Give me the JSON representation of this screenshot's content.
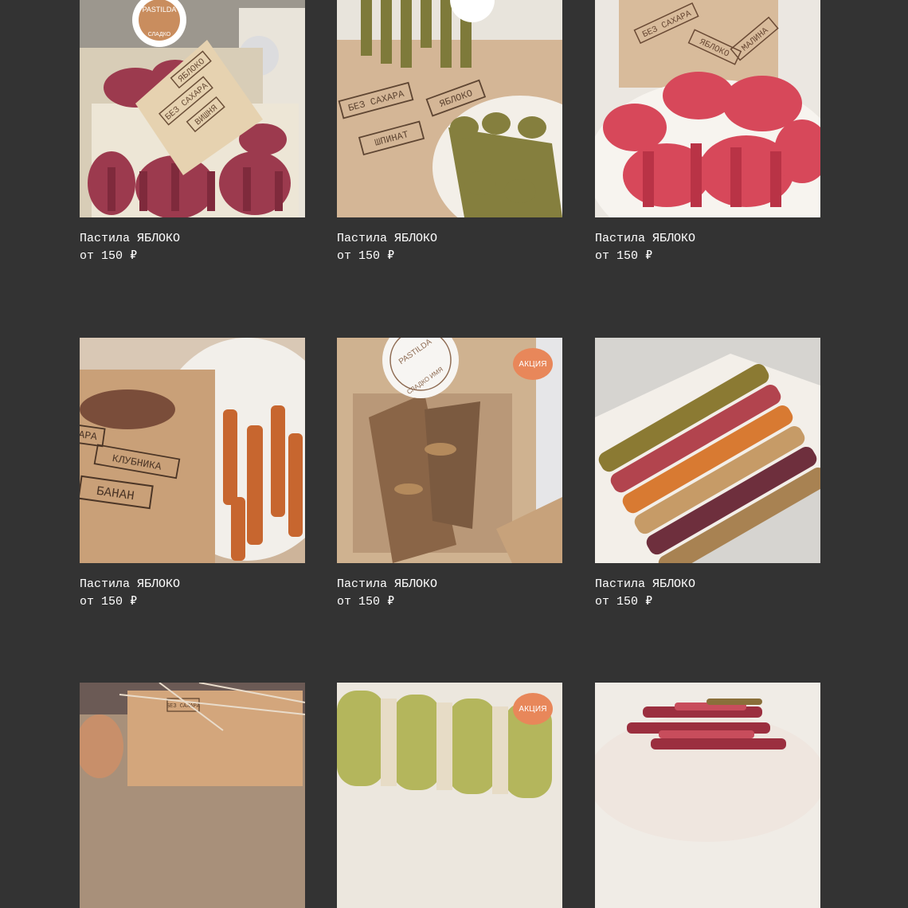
{
  "products": [
    {
      "title": "Пастила ЯБЛОКО",
      "price_prefix": "от",
      "price": "150",
      "currency": "₽",
      "photo": "red-rolls-in-box-photo",
      "badge": ""
    },
    {
      "title": "Пастила ЯБЛОКО",
      "price_prefix": "от",
      "price": "150",
      "currency": "₽",
      "photo": "green-rolls-spinach-photo",
      "badge": ""
    },
    {
      "title": "Пастила ЯБЛОКО",
      "price_prefix": "от",
      "price": "150",
      "currency": "₽",
      "photo": "red-rolls-raspberry-photo",
      "badge": ""
    },
    {
      "title": "Пастила ЯБЛОКО",
      "price_prefix": "от",
      "price": "150",
      "currency": "₽",
      "photo": "orange-rolls-banana-photo",
      "badge": ""
    },
    {
      "title": "Пастила ЯБЛОКО",
      "price_prefix": "от",
      "price": "150",
      "currency": "₽",
      "photo": "brown-pastila-package-photo",
      "badge": "АКЦИЯ"
    },
    {
      "title": "Пастила ЯБЛОКО",
      "price_prefix": "от",
      "price": "150",
      "currency": "₽",
      "photo": "assorted-rolls-box-photo",
      "badge": ""
    },
    {
      "title": "",
      "price_prefix": "",
      "price": "",
      "currency": "",
      "photo": "gift-box-twine-photo",
      "badge": ""
    },
    {
      "title": "",
      "price_prefix": "",
      "price": "",
      "currency": "",
      "photo": "green-pastila-bars-photo",
      "badge": "АКЦИЯ"
    },
    {
      "title": "",
      "price_prefix": "",
      "price": "",
      "currency": "",
      "photo": "stacked-red-rolls-photo",
      "badge": ""
    }
  ],
  "stamp_labels": {
    "p0": [
      "БЕЗ САХАРА",
      "ЯБЛОКО",
      "ВИШНЯ"
    ],
    "p1": [
      "БЕЗ САХАРА",
      "ЯБЛОКО",
      "ШПИНАТ"
    ],
    "p2": [
      "БЕЗ САХАРА",
      "ЯБЛОКО",
      "МАЛИНА"
    ],
    "p3": [
      "АРА",
      "КЛУБНИКА",
      "БАНАН"
    ],
    "p4": [
      "PASTILDA",
      "СЛАДКО ИМЯ"
    ],
    "p6": [
      "БЕЗ САХАРА"
    ]
  },
  "colors": {
    "background": "#333333",
    "text": "#ffffff",
    "badge": "#e8875a"
  }
}
